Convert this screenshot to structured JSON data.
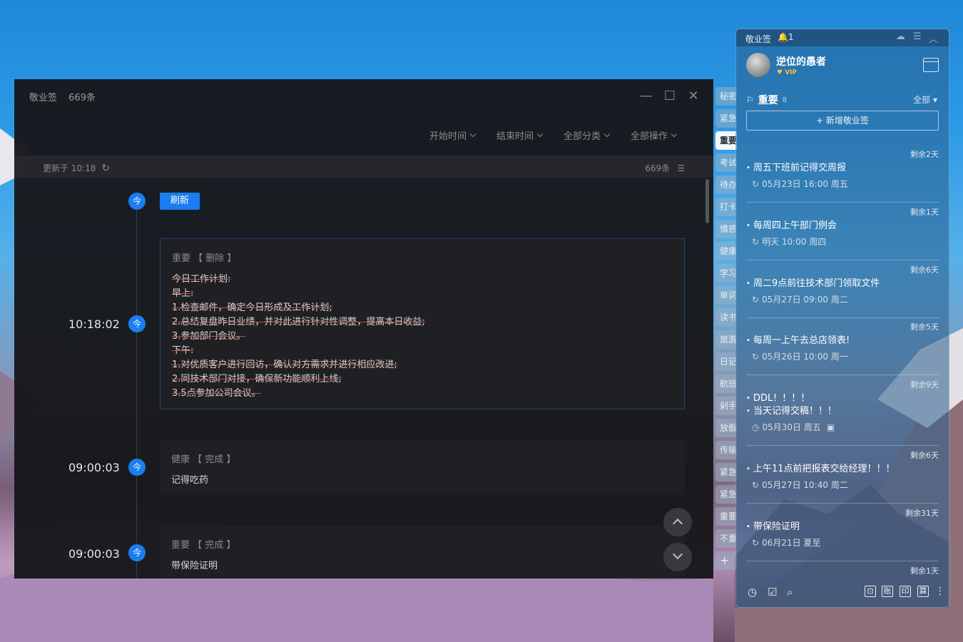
{
  "main": {
    "app_name": "敬业签",
    "total": "669条",
    "filters": [
      "开始时间",
      "结束时间",
      "全部分类",
      "全部操作"
    ],
    "updated": "更新于 10:18",
    "count": "669条",
    "refresh_label": "刷新",
    "today_badge": "今",
    "entries": [
      {
        "time": "10:18:02",
        "category": "重要",
        "action": "【 删除 】",
        "lines": [
          "今日工作计划:",
          "早上:",
          "1.检查邮件，确定今日形成及工作计划;",
          "2.总结复盘昨日业绩，并对此进行针对性调整，提高本日收益;",
          "3.参加部门会议。",
          "下午:",
          "1.对优质客户进行回访，确认对方需求并进行相应改进;",
          "2.同技术部门对接，确保新功能顺利上线;",
          "3.5点参加公司会议。"
        ]
      },
      {
        "time": "09:00:03",
        "category": "健康",
        "action": "【 完成 】",
        "text": "记得吃药"
      },
      {
        "time": "09:00:03",
        "category": "重要",
        "action": "【 完成 】",
        "text": "带保险证明"
      }
    ]
  },
  "tabs": [
    "秘密",
    "紧急",
    "重要",
    "考试",
    "待办",
    "打卡",
    "情感",
    "健康",
    "学习",
    "单词",
    "读书",
    "旅游",
    "日记",
    "航班",
    "剁手",
    "放假",
    "传输",
    "紧急",
    "紧急",
    "重要",
    "不重"
  ],
  "tabs_add": "+",
  "panel": {
    "app_name": "敬业签",
    "bell_count": "1",
    "username": "逆位的愚者",
    "vip": "VIP",
    "section": "重要",
    "section_count": "8",
    "filter": "全部",
    "add_label": "+ 新增敬业签",
    "items": [
      {
        "remain": "剩余2天",
        "title": "周五下班前记得交周报",
        "sub": "05月23日 16:00 周五"
      },
      {
        "remain": "剩余1天",
        "title": "每周四上午部门例会",
        "sub": "明天 10:00 周四"
      },
      {
        "remain": "剩余6天",
        "title": "周二9点前往技术部门领取文件",
        "sub": "05月27日 09:00 周二"
      },
      {
        "remain": "剩余5天",
        "title": "每周一上午去总店领表!",
        "sub": "05月26日 10:00 周一"
      },
      {
        "remain": "剩余9天",
        "title": "DDL！！！！",
        "title2": "当天记得交稿！！！",
        "sub": "05月30日 周五"
      },
      {
        "remain": "剩余6天",
        "title": "上午11点前把报表交给经理！！！",
        "sub": "05月27日 10:40 周二"
      },
      {
        "remain": "剩余31天",
        "title": "带保险证明",
        "sub": "06月21日 夏至"
      },
      {
        "remain": "剩余1天"
      }
    ],
    "bottom_icons": [
      "⊡",
      "账",
      "印",
      "算"
    ]
  }
}
